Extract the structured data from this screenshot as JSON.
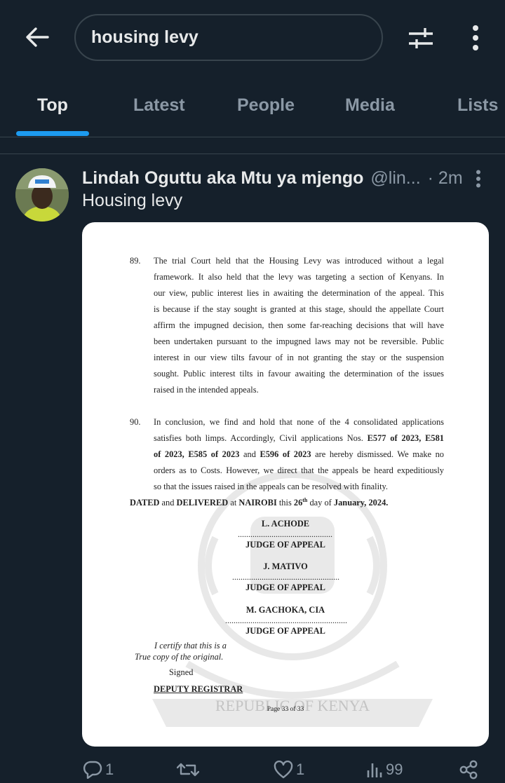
{
  "search": {
    "query": "housing levy"
  },
  "tabs": [
    {
      "label": "Top",
      "active": true
    },
    {
      "label": "Latest",
      "active": false
    },
    {
      "label": "People",
      "active": false
    },
    {
      "label": "Media",
      "active": false
    },
    {
      "label": "Lists",
      "active": false
    }
  ],
  "post": {
    "author": "Lindah Oguttu aka Mtu ya mjengo",
    "handle": "@lin...",
    "time": "· 2m",
    "text": "Housing levy",
    "stats": {
      "replies": "1",
      "reposts": "",
      "likes": "1",
      "views": "99"
    }
  },
  "document": {
    "para89_num": "89.",
    "para89_lines": [
      "The trial Court held that the Housing Levy was introduced without a legal",
      "framework.  It also held that the levy was targeting a section of Kenyans.  In",
      "our view, public interest lies in awaiting the determination of the appeal. This",
      "is because if the stay sought is granted at this stage, should the appellate Court",
      "affirm the impugned decision, then some far-reaching decisions that will have",
      "been undertaken pursuant to the impugned laws may not be reversible. Public",
      "interest in our view tilts favour of in not granting the stay or the suspension",
      "sought. Public interest tilts in favour awaiting the determination of the issues",
      "raised in the intended appeals."
    ],
    "para90_num": "90.",
    "para90_lines": [
      "In conclusion, we find and hold that none of the 4 consolidated applications",
      "satisfies both limps. Accordingly, Civil applications Nos. E577 of 2023, E581",
      "of 2023, E585 of 2023 and E596 of 2023 are hereby dismissed.  We make no",
      "orders as to Costs. However, we direct that the appeals be heard expeditiously",
      "so that the issues raised in the appeals can be resolved with finality."
    ],
    "dated": "DATED and DELIVERED at NAIROBI this 26th day of January, 2024.",
    "judges": [
      {
        "name": "L. ACHODE",
        "title": "JUDGE OF APPEAL"
      },
      {
        "name": "J. MATIVO",
        "title": "JUDGE OF APPEAL"
      },
      {
        "name": "M. GACHOKA, CIA",
        "title": "JUDGE OF APPEAL"
      }
    ],
    "certify_1": "I certify that this is a",
    "certify_2": "True copy of the original.",
    "signed": "Signed",
    "registrar": "DEPUTY REGISTRAR",
    "page": "Page 33 of 33",
    "seal_text": "REPUBLIC OF KENYA"
  }
}
